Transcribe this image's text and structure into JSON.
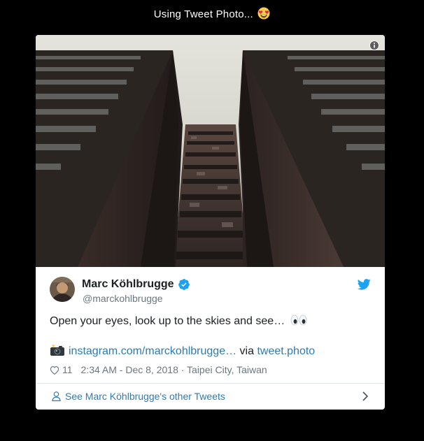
{
  "page": {
    "title": "Using Tweet Photo...",
    "title_emoji": "heart-eyes-emoji"
  },
  "embed": {
    "photo_description_icon": "info-icon",
    "author": {
      "name": "Marc Köhlbrugge",
      "handle": "@marckohlbrugge",
      "verified": true,
      "verified_color": "#1da1f2"
    },
    "brand_icon": "twitter-bird-icon",
    "brand_color": "#1da1f2",
    "text": "Open your eyes, look up to the skies and see…",
    "text_emoji": "eyes-emoji",
    "link": {
      "icon": "camera-flash-icon",
      "url_text": "instagram.com/marckohlbrugge…",
      "via_text": "via",
      "via_link": "tweet.photo"
    },
    "meta": {
      "like_icon": "heart-outline-icon",
      "like_count": "11",
      "timestamp": "2:34 AM - Dec 8, 2018 · Taipei City, Taiwan"
    },
    "footer": {
      "icon": "person-icon",
      "label": "See Marc Köhlbrugge's other Tweets",
      "chevron": "chevron-right-icon"
    },
    "colors": {
      "link": "#2b7bb9",
      "text": "#1c2022",
      "muted": "#697882",
      "divider": "#e1e8ed"
    }
  }
}
